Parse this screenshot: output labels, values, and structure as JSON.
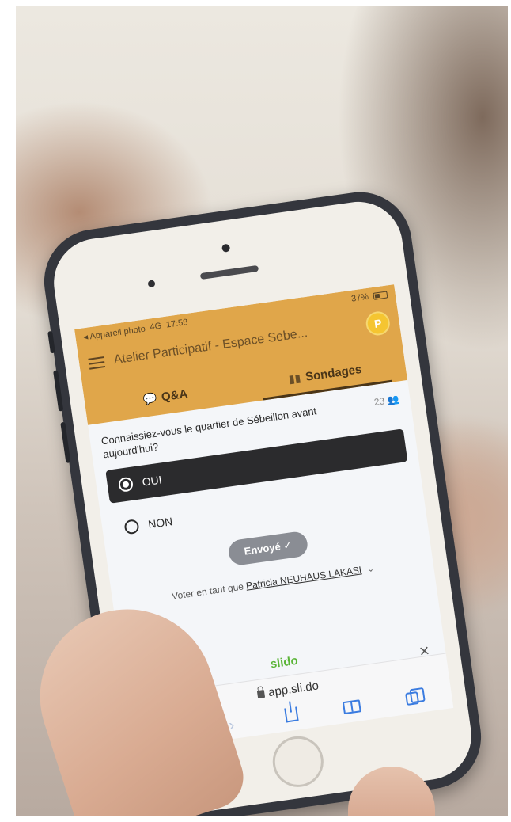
{
  "status_bar": {
    "carrier": "◂ Appareil photo",
    "network": "4G",
    "time": "17:58",
    "battery": "37%"
  },
  "header": {
    "event_title": "Atelier Participatif - Espace Sebe...",
    "avatar_initial": "P",
    "tabs": [
      {
        "label": "Q&A"
      },
      {
        "label": "Sondages"
      }
    ]
  },
  "poll": {
    "question": "Connaissiez-vous le quartier de Sébeillon avant aujourd'hui?",
    "voter_count": "23",
    "options": [
      {
        "label": "OUI",
        "selected": true
      },
      {
        "label": "NON",
        "selected": false
      }
    ],
    "sent_label": "Envoyé ✓",
    "vote_as_prefix": "Voter en tant que",
    "voter_name": "Patricia NEUHAUS LAKASI"
  },
  "brand": "slido",
  "browser": {
    "url": "app.sli.do",
    "close_glyph": "×"
  },
  "colors": {
    "header": "#e0a64a",
    "selected_option": "#2b2b2d",
    "sent_button": "#8a8d94",
    "brand_green": "#5bb538",
    "browser_blue": "#3b7ce0"
  }
}
